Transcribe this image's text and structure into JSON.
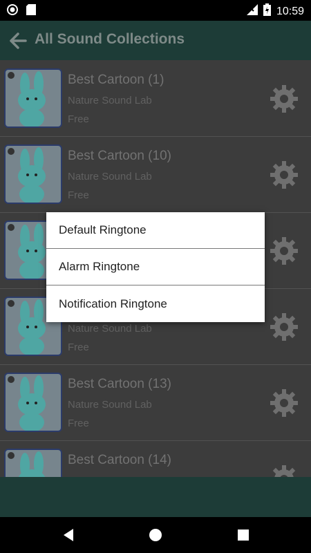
{
  "status_bar": {
    "time": "10:59"
  },
  "app_bar": {
    "title": "All Sound Collections"
  },
  "list": [
    {
      "title": "Best Cartoon (1)",
      "subtitle": "Nature Sound Lab",
      "price": "Free"
    },
    {
      "title": "Best Cartoon (10)",
      "subtitle": "Nature Sound Lab",
      "price": "Free"
    },
    {
      "title": "",
      "subtitle": "",
      "price": ""
    },
    {
      "title": "",
      "subtitle": "Nature Sound Lab",
      "price": "Free"
    },
    {
      "title": "Best Cartoon (13)",
      "subtitle": "Nature Sound Lab",
      "price": "Free"
    },
    {
      "title": "Best Cartoon (14)",
      "subtitle": "",
      "price": ""
    }
  ],
  "dialog": {
    "items": [
      {
        "label": "Default Ringtone"
      },
      {
        "label": "Alarm Ringtone"
      },
      {
        "label": "Notification Ringtone"
      }
    ]
  },
  "colors": {
    "app_bar": "#1d3c37",
    "list_bg": "#3c3c3c",
    "dialog_bg": "#ffffff"
  }
}
